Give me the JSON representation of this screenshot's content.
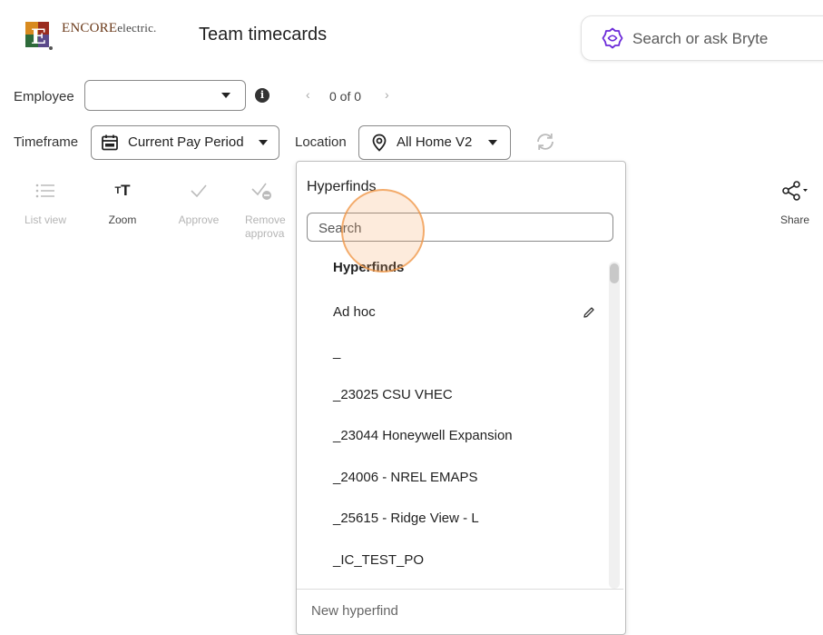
{
  "header": {
    "logo_brand": "ENCORE",
    "logo_suffix": "electric.",
    "page_title": "Team timecards",
    "search_placeholder": "Search or ask Bryte"
  },
  "filters": {
    "employee_label": "Employee",
    "employee_value": "",
    "pagination_text": "0 of 0",
    "timeframe_label": "Timeframe",
    "timeframe_value": "Current Pay Period",
    "location_label": "Location",
    "location_value": "All Home V2"
  },
  "toolbar": {
    "list_view": "List view",
    "zoom": "Zoom",
    "approve": "Approve",
    "remove_approval_line1": "Remove",
    "remove_approval_line2": "approva",
    "share": "Share"
  },
  "dropdown": {
    "title": "Hyperfinds",
    "search_placeholder": "Search",
    "items": [
      {
        "label": "Hyperfinds",
        "bold": true
      },
      {
        "label": "Ad hoc",
        "bold": false,
        "editable": true
      },
      {
        "label": "_",
        "bold": false
      },
      {
        "label": "_23025 CSU VHEC",
        "bold": false
      },
      {
        "label": "_23044 Honeywell Expansion",
        "bold": false
      },
      {
        "label": "_24006 - NREL EMAPS",
        "bold": false
      },
      {
        "label": "_25615 - Ridge View - L",
        "bold": false
      },
      {
        "label": "_IC_TEST_PO",
        "bold": false
      }
    ],
    "new_hyperfind": "New hyperfind"
  },
  "colors": {
    "accent_purple": "#6c2bd9",
    "click_highlight": "#f0964a",
    "disabled_text": "#b5b5b5"
  }
}
